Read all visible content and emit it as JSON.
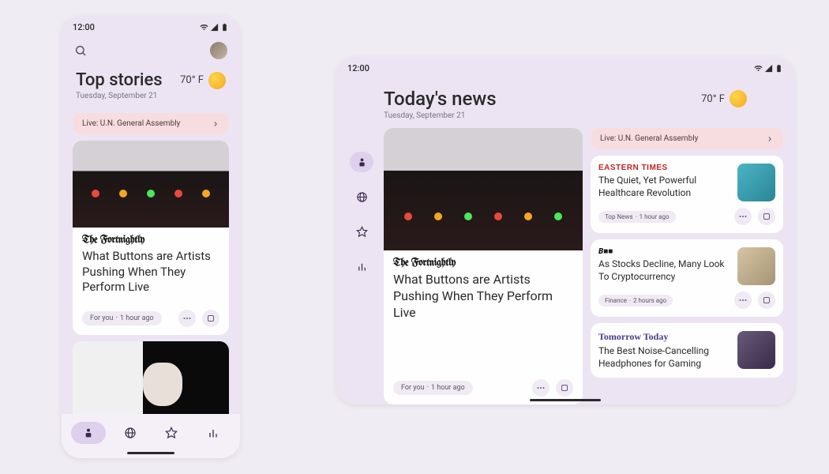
{
  "phone": {
    "time": "12:00",
    "title": "Top stories",
    "date": "Tuesday, September 21",
    "weather": "70° F",
    "live": "Live: U.N. General Assembly",
    "article": {
      "source": "The Fortnightly",
      "title": "What Buttons are Artists Pushing When They Perform Live",
      "tag": "For you",
      "time": "1 hour ago"
    }
  },
  "tablet": {
    "time": "12:00",
    "title": "Today's news",
    "date": "Tuesday, September 21",
    "weather": "70° F",
    "live": "Live: U.N. General Assembly",
    "main": {
      "source": "The Fortnightly",
      "title": "What Buttons are Artists Pushing When They Perform Live",
      "tag": "For you",
      "time": "1 hour ago"
    },
    "side": [
      {
        "source": "EASTERN TIMES",
        "title": "The Quiet, Yet Powerful Healthcare Revolution",
        "tag": "Top News",
        "time": "1 hour ago"
      },
      {
        "source": "B■■",
        "title": "As Stocks Decline, Many Look To Cryptocurrency",
        "tag": "Finance",
        "time": "2 hours ago"
      },
      {
        "source": "Tomorrow Today",
        "title": "The Best Noise-Cancelling Headphones for Gaming",
        "tag": "",
        "time": ""
      }
    ]
  }
}
